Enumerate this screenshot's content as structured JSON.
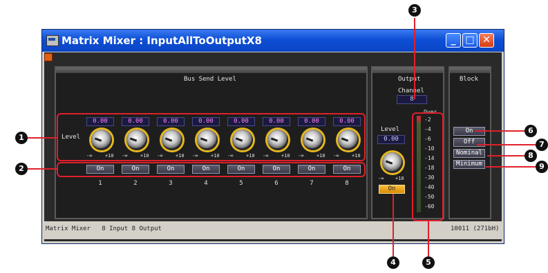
{
  "window": {
    "title": "Matrix Mixer : InputAllToOutputX8",
    "buttons": {
      "minimize": "_",
      "maximize": "□",
      "close": "✕"
    }
  },
  "bus_send": {
    "title": "Bus Send Level",
    "level_label": "Level",
    "channels": [
      {
        "value": "0.00",
        "on": "On",
        "num": "1"
      },
      {
        "value": "0.00",
        "on": "On",
        "num": "2"
      },
      {
        "value": "0.00",
        "on": "On",
        "num": "3"
      },
      {
        "value": "0.00",
        "on": "On",
        "num": "4"
      },
      {
        "value": "0.00",
        "on": "On",
        "num": "5"
      },
      {
        "value": "0.00",
        "on": "On",
        "num": "6"
      },
      {
        "value": "0.00",
        "on": "On",
        "num": "7"
      },
      {
        "value": "0.00",
        "on": "On",
        "num": "8"
      }
    ],
    "scale_min": "-∞",
    "scale_max": "+10"
  },
  "output": {
    "title": "Output",
    "channel_label": "Channel",
    "channel_value": "8",
    "level_label": "Level",
    "level_value": "0.00",
    "on_label": "On",
    "scale_min": "-∞",
    "scale_max": "+10",
    "meter_over": "Over",
    "meter_ticks": [
      "-2",
      "-4",
      "-6",
      "-10",
      "-14",
      "-18",
      "-30",
      "-40",
      "-50",
      "-60"
    ]
  },
  "block": {
    "title": "Block",
    "buttons": [
      "On",
      "Off",
      "Nominal",
      "Minimum"
    ]
  },
  "status": {
    "left": "Matrix Mixer   8 Input 8 Output",
    "right": "10011 (271bH)"
  },
  "callouts": [
    "1",
    "2",
    "3",
    "4",
    "5",
    "6",
    "7",
    "8",
    "9"
  ],
  "colors": {
    "accent": "#e0202a",
    "knob_ring": "#e8b820",
    "title_bar": "#0e4fd6"
  }
}
